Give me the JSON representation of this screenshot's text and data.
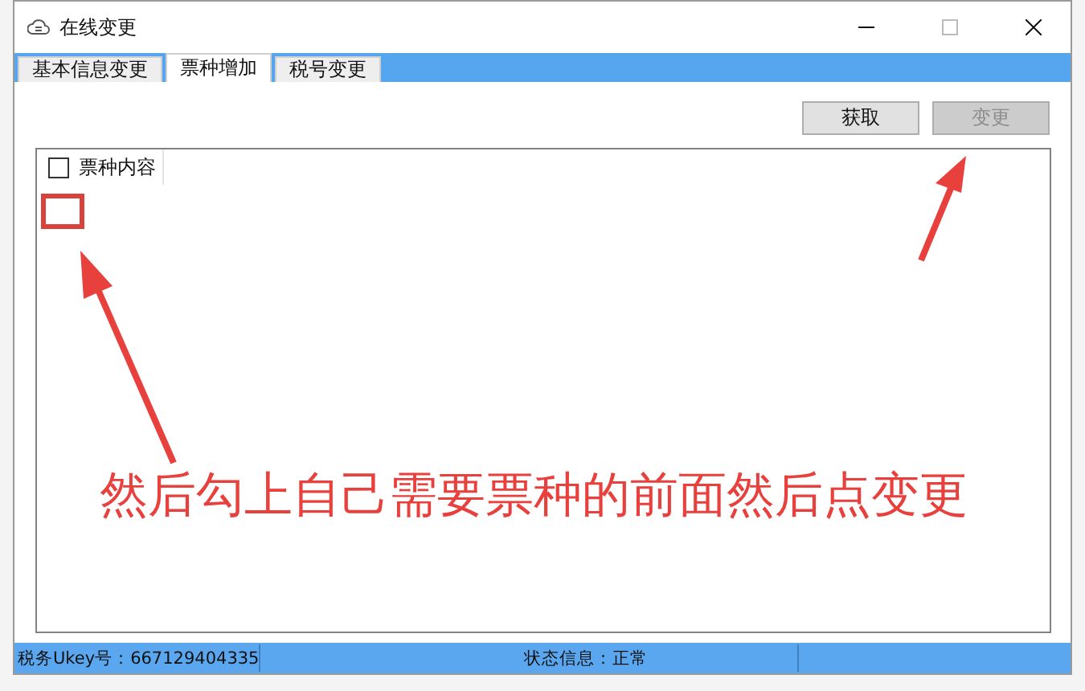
{
  "window": {
    "title": "在线变更"
  },
  "tabs": [
    {
      "label": "基本信息变更",
      "selected": false
    },
    {
      "label": "票种增加",
      "selected": true
    },
    {
      "label": "税号变更",
      "selected": false
    }
  ],
  "buttons": [
    {
      "label": "获取",
      "disabled": false
    },
    {
      "label": "变更",
      "disabled": true
    }
  ],
  "table": {
    "header_checked": false,
    "columns": [
      "票种内容"
    ]
  },
  "annotation": {
    "text": "然后勾上自己需要票种的前面然后点变更"
  },
  "status_bar": [
    {
      "text": "税务Ukey号：667129404335"
    },
    {
      "text": "状态信息：正常"
    }
  ]
}
